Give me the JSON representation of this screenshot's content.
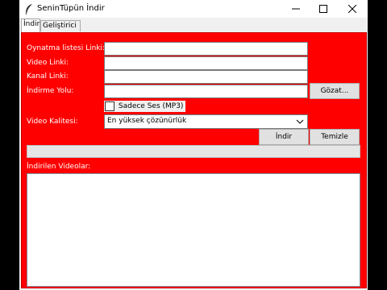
{
  "window": {
    "title": "SeninTüpün İndir",
    "icon": "feather-icon",
    "controls": {
      "minimize": "minimize-icon",
      "maximize": "maximize-icon",
      "close": "close-icon"
    }
  },
  "tabs": [
    {
      "label": "İndir",
      "active": true
    },
    {
      "label": "Geliştirici",
      "active": false
    }
  ],
  "form": {
    "playlist_label": "Oynatma listesi Linki:",
    "playlist_value": "",
    "video_label": "Video Linki:",
    "video_value": "",
    "channel_label": "Kanal Linki:",
    "channel_value": "",
    "download_path_label": "İndirme Yolu:",
    "download_path_value": "",
    "browse_button": "Gözat...",
    "audio_only_label": "Sadece Ses (MP3)",
    "audio_only_checked": false,
    "quality_label": "Video Kalitesi:",
    "quality_selected": "En yüksek çözünürlük",
    "download_button": "İndir",
    "clear_button": "Temizle"
  },
  "progress": {
    "value": 0
  },
  "downloaded": {
    "label": "İndirilen Videolar:",
    "items": []
  },
  "colors": {
    "panel_background": "#ff0000",
    "label_text": "#ffffff",
    "window_background": "#f0f0f0"
  }
}
